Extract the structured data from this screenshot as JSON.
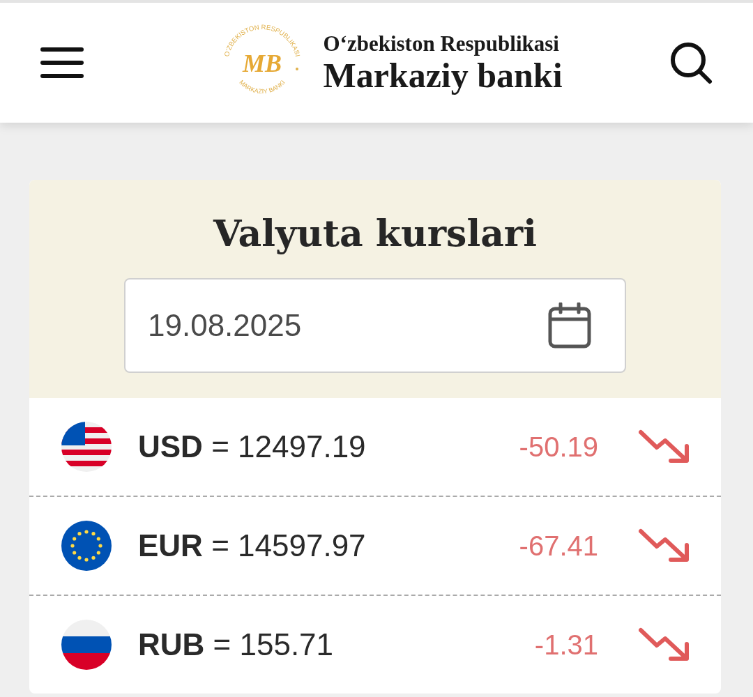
{
  "header": {
    "logo": {
      "monogram": "MB",
      "ring_top": "O‘ZBEKISTON RESPUBLIKASI",
      "ring_bottom": "MARKAZIY BANKI"
    },
    "subtitle": "O‘zbekiston Respublikasi",
    "title": "Markaziy banki"
  },
  "card": {
    "title": "Valyuta kurslari",
    "date_field": {
      "value": "19.08.2025"
    },
    "rates": [
      {
        "flag": {
          "kind": "us"
        },
        "rate": "**USD** = 12497.19",
        "change": "-50.19",
        "trend": {
          "kind": "down"
        }
      },
      {
        "flag": {
          "kind": "eu"
        },
        "rate": "**EUR** = 14597.97",
        "change": "-67.41",
        "trend": {
          "kind": "down"
        }
      },
      {
        "flag": {
          "kind": "ru"
        },
        "rate": "**RUB** = 155.71",
        "change": "-1.31",
        "trend": {
          "kind": "down"
        }
      }
    ]
  }
}
